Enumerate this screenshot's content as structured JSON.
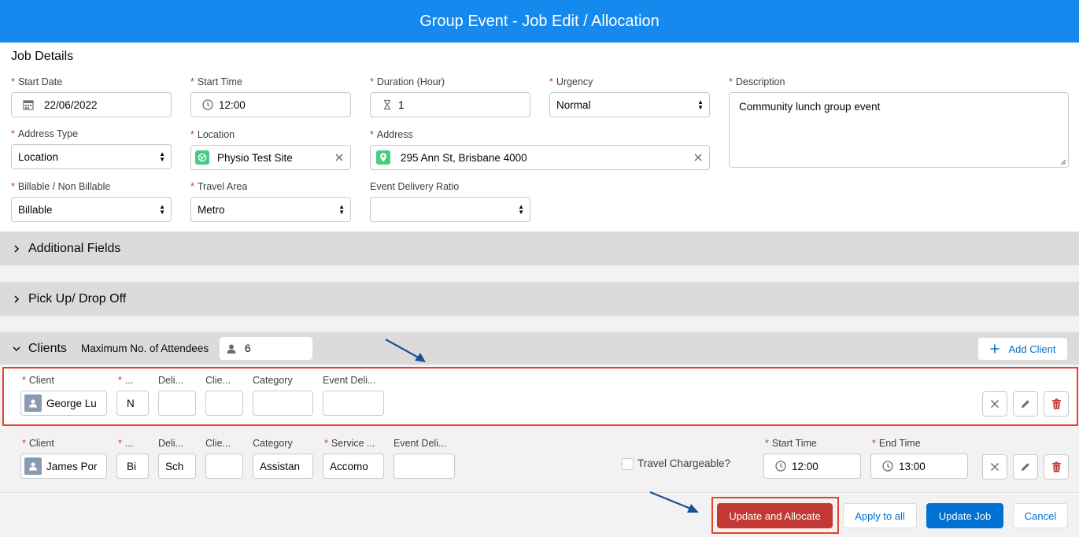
{
  "header": {
    "title": "Group Event - Job Edit / Allocation"
  },
  "job_details": {
    "title": "Job Details",
    "start_date": {
      "label": "Start Date",
      "value": "22/06/2022"
    },
    "start_time": {
      "label": "Start Time",
      "value": "12:00"
    },
    "duration": {
      "label": "Duration (Hour)",
      "value": "1"
    },
    "urgency": {
      "label": "Urgency",
      "value": "Normal"
    },
    "description": {
      "label": "Description",
      "value": "Community lunch group event"
    },
    "address_type": {
      "label": "Address Type",
      "value": "Location"
    },
    "location": {
      "label": "Location",
      "value": "Physio Test Site"
    },
    "address": {
      "label": "Address",
      "value": "295 Ann St, Brisbane 4000"
    },
    "billable": {
      "label": "Billable / Non Billable",
      "value": "Billable"
    },
    "travel_area": {
      "label": "Travel Area",
      "value": "Metro"
    },
    "event_delivery_ratio": {
      "label": "Event Delivery Ratio",
      "value": ""
    }
  },
  "sections": {
    "additional_fields": "Additional Fields",
    "pickup_dropoff": "Pick Up/ Drop Off",
    "clients": "Clients"
  },
  "clients": {
    "max_attendees_label": "Maximum No. of Attendees",
    "max_attendees_value": "6",
    "add_client_label": "Add Client",
    "row1": {
      "client_label": "Client",
      "client_value": "George Lu",
      "f2_label": "...",
      "f2_value": "N",
      "deli_label": "Deli...",
      "clie_label": "Clie...",
      "category_label": "Category",
      "event_deli_label": "Event Deli..."
    },
    "row2": {
      "client_label": "Client",
      "client_value": "James Por",
      "f2_label": "...",
      "f2_value": "Bi",
      "deli_label": "Deli...",
      "deli_value": "Sch",
      "clie_label": "Clie...",
      "category_label": "Category",
      "category_value": "Assistan",
      "service_label": "Service ...",
      "service_value": "Accomo",
      "event_deli_label": "Event Deli...",
      "travel_chargeable_label": "Travel Chargeable?",
      "start_time_label": "Start Time",
      "start_time_value": "12:00",
      "end_time_label": "End Time",
      "end_time_value": "13:00"
    }
  },
  "footer": {
    "update_allocate": "Update and Allocate",
    "apply_all": "Apply to all",
    "update_job": "Update Job",
    "cancel": "Cancel"
  },
  "colors": {
    "header": "#1589ee",
    "brand_button": "#0070d2",
    "destructive_button": "#c23934",
    "highlight_border": "#e8402a",
    "arrow": "#1b4f9c",
    "required": "#c23934"
  }
}
